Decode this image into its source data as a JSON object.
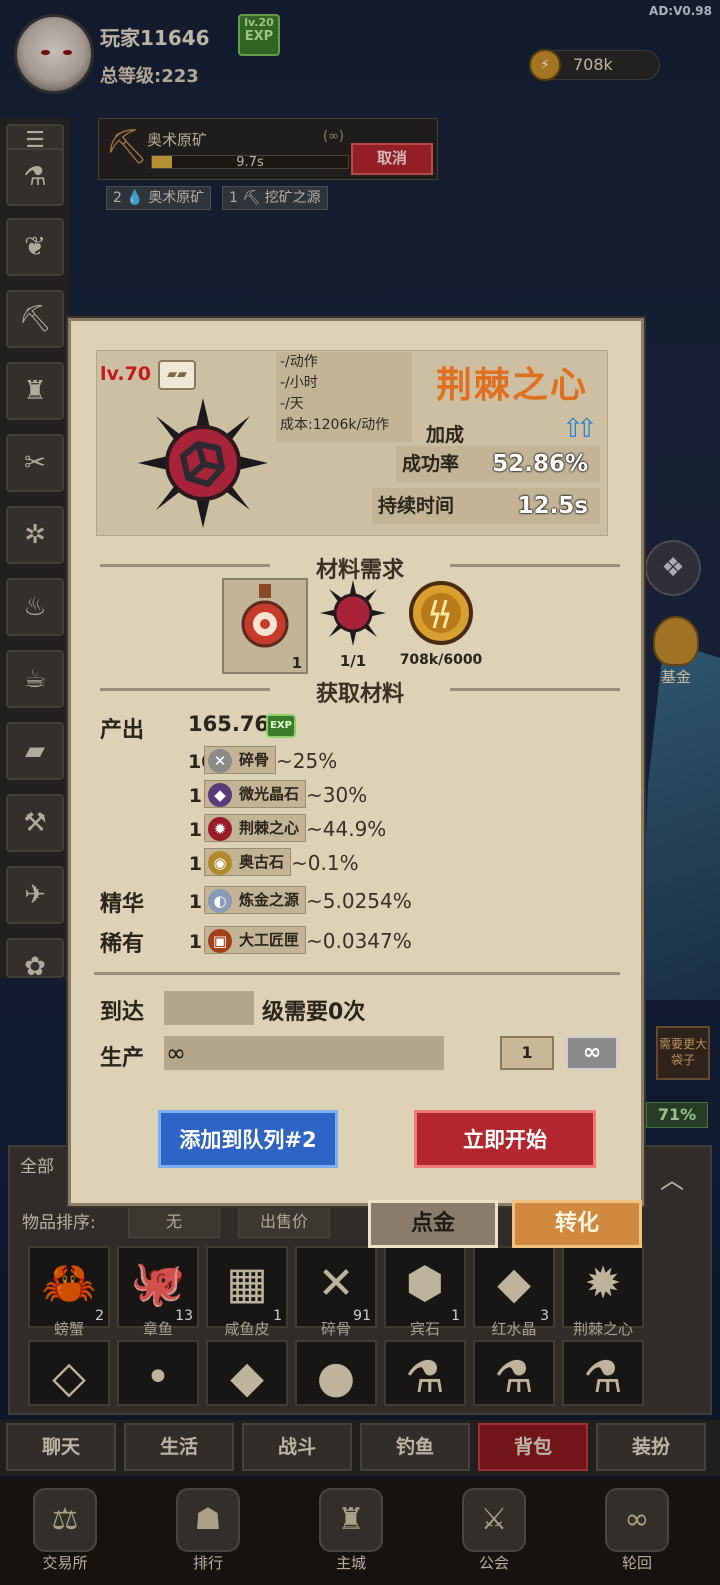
{
  "version": "AD:V0.98",
  "player": {
    "name": "玩家11646",
    "total_level": "总等级:223",
    "exp_level": "lv.20",
    "exp_badge": "EXP"
  },
  "currency": {
    "coins": "708k"
  },
  "mining": {
    "name": "奥术原矿",
    "repeat": "(∞)",
    "time": "9.7s",
    "cancel": "取消",
    "progress": 0.1,
    "tags": [
      {
        "count": "2",
        "name": "奥术原矿"
      },
      {
        "count": "1",
        "name": "挖矿之源"
      }
    ]
  },
  "right": {
    "fund": "基金",
    "need_big_bag": "需要更大袋子",
    "percent": "71%"
  },
  "modal": {
    "level": "lv.70",
    "stats_lines": [
      "-/动作",
      "-/小时",
      "-/天",
      "成本:1206k/动作"
    ],
    "title": "荆棘之心",
    "bonus": "加成",
    "success_label": "成功率",
    "success_value": "52.86%",
    "duration_label": "持续时间",
    "duration_value": "12.5s",
    "materials_header": "材料需求",
    "materials": [
      {
        "icon": "potion-icon",
        "count": "1"
      },
      {
        "icon": "thorn-heart-icon",
        "count": "1/1"
      },
      {
        "icon": "coin-icon",
        "count": "708k/6000"
      }
    ],
    "obtain_header": "获取材料",
    "output_label": "产出",
    "output_value": "165.76",
    "exp": "EXP",
    "drops": [
      {
        "qty": "10",
        "name": "碎骨",
        "pct": "~25%",
        "color": "#8a8a8a",
        "glyph": "✕"
      },
      {
        "qty": "1",
        "name": "微光晶石",
        "pct": "~30%",
        "color": "#5a3a7a",
        "glyph": "◆"
      },
      {
        "qty": "1",
        "name": "荆棘之心",
        "pct": "~44.9%",
        "color": "#9a1a2a",
        "glyph": "✹"
      },
      {
        "qty": "1",
        "name": "奥古石",
        "pct": "~0.1%",
        "color": "#b08a2a",
        "glyph": "◉"
      }
    ],
    "essence_label": "精华",
    "essence": {
      "qty": "1",
      "name": "炼金之源",
      "pct": "~5.0254%",
      "color": "#8a9ab4",
      "glyph": "◐"
    },
    "rare_label": "稀有",
    "rare": {
      "qty": "1",
      "name": "大工匠匣",
      "pct": "~0.0347%",
      "color": "#a0401a",
      "glyph": "▣"
    },
    "reach_prefix": "到达",
    "reach_suffix": "级需要0次",
    "produce_label": "生产",
    "produce_value": "∞",
    "qty_one": "1",
    "qty_inf": "∞",
    "queue_button": "添加到队列#2",
    "start_button": "立即开始"
  },
  "bag": {
    "filter_label": "全部",
    "sort_label": "物品排序:",
    "sort_none": "无",
    "sort_price": "出售价",
    "tab_gold": "点金",
    "tab_convert": "转化",
    "row1": [
      {
        "name": "螃蟹",
        "count": "2",
        "glyph": "🦀"
      },
      {
        "name": "章鱼",
        "count": "13",
        "glyph": "🐙"
      },
      {
        "name": "咸鱼皮",
        "count": "1",
        "glyph": "▦"
      },
      {
        "name": "碎骨",
        "count": "91",
        "glyph": "✕"
      },
      {
        "name": "宾石",
        "count": "1",
        "glyph": "⬢"
      },
      {
        "name": "红水晶",
        "count": "3",
        "glyph": "◆"
      },
      {
        "name": "荆棘之心",
        "count": "",
        "glyph": "✹"
      }
    ],
    "row2": [
      {
        "glyph": "◇"
      },
      {
        "glyph": "•"
      },
      {
        "glyph": "◆"
      },
      {
        "glyph": "●"
      },
      {
        "glyph": "⚗"
      },
      {
        "glyph": "⚗"
      },
      {
        "glyph": "⚗"
      }
    ]
  },
  "tabs": [
    "聊天",
    "生活",
    "战斗",
    "钓鱼",
    "背包",
    "装扮"
  ],
  "nav": [
    "交易所",
    "排行",
    "主城",
    "公会",
    "轮回"
  ],
  "colors": {
    "accent_red": "#b3262d",
    "title_orange": "#e07020",
    "queue_blue": "#2f63c4"
  }
}
